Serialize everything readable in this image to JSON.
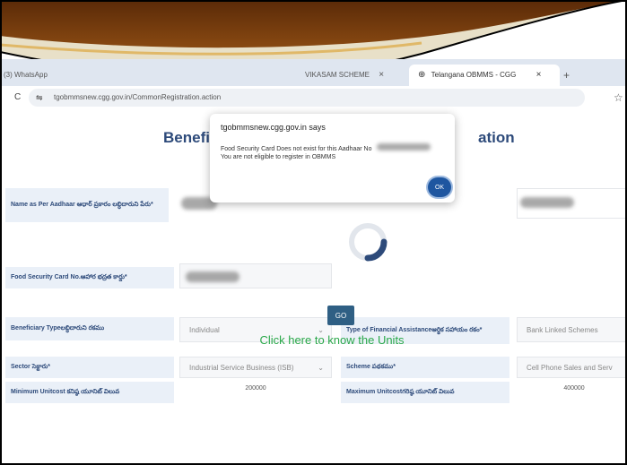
{
  "browser": {
    "tabs": [
      {
        "label": "(3) WhatsApp"
      },
      {
        "label": "VIKASAM SCHEME",
        "close": "×"
      },
      {
        "label": "Telangana OBMMS - CGG",
        "close": "×"
      },
      {
        "label": "+"
      }
    ],
    "url": "tgobmmsnew.cgg.gov.in/CommonRegistration.action",
    "star": "☆",
    "reload": "C"
  },
  "page": {
    "title_left": "Benefi",
    "title_right": "ation",
    "fields": {
      "name_label": "Name as Per Aadhaar ఆధార్ ప్రకారం లబ్ధిదారుని పేరు*",
      "food_label": "Food Security Card No.ఆహార భద్రత కార్డు*",
      "beneficiary_type_label": "Beneficiary Typeలబ్ధిదారుని రకము",
      "beneficiary_type_value": "Individual",
      "assistance_label": "Type of Financial Assistanceఆర్థిక సహాయం రకం*",
      "assistance_value": "Bank Linked Schemes",
      "sector_label": "Sector సెక్టారు*",
      "sector_value": "Industrial Service Business (ISB)",
      "scheme_label": "Scheme పథకము*",
      "scheme_value": "Cell Phone Sales and Serv",
      "min_label": "Minimum Unitcost కనిష్ఠ యూనిట్ విలువ",
      "min_value": "200000",
      "max_label": "Maximum Unitcostగరిష్ఠ యూనిట్ విలువ",
      "max_value": "400000"
    },
    "go_label": "GO",
    "units_link": "Click here to know the Units"
  },
  "dialog": {
    "title": "tgobmmsnew.cgg.gov.in says",
    "line1": "Food Security Card Does not exist for this Aadhaar No",
    "line2": "You are not eligible to register in OBMMS",
    "ok_label": "OK"
  },
  "colors": {
    "accent": "#2d4a7a",
    "ok": "#1e56a0",
    "link": "#2aa84a"
  }
}
